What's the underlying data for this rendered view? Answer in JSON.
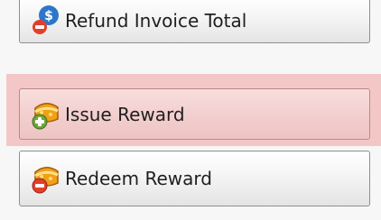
{
  "buttons": {
    "refund": {
      "label": "Refund Invoice Total",
      "icon": "refund-dollar-icon"
    },
    "issue": {
      "label": "Issue Reward",
      "icon": "treasure-add-icon"
    },
    "redeem": {
      "label": "Redeem Reward",
      "icon": "treasure-remove-icon"
    }
  },
  "colors": {
    "highlight": "#f4c7c7",
    "button_border": "#8e8e8e",
    "text": "#1f1f1f"
  }
}
